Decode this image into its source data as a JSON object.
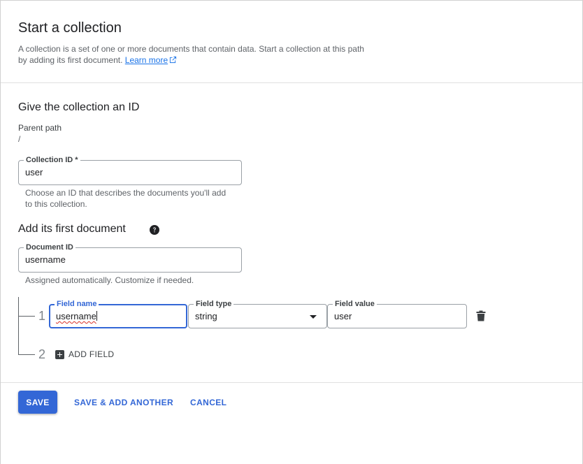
{
  "dialog": {
    "title": "Start a collection",
    "description_line1": "A collection is a set of one or more documents that contain data. Start a collection at this path",
    "description_line2": "by adding its first document.",
    "learn_more": "Learn more"
  },
  "collection_section": {
    "title": "Give the collection an ID",
    "parent_path_label": "Parent path",
    "parent_path_value": "/",
    "collection_id_label": "Collection ID *",
    "collection_id_value": "user",
    "collection_id_hint": "Choose an ID that describes the documents you'll add to this collection."
  },
  "document_section": {
    "title": "Add its first document",
    "document_id_label": "Document ID",
    "document_id_value": "username",
    "document_id_hint": "Assigned automatically. Customize if needed."
  },
  "fields": [
    {
      "index": "1",
      "name_label": "Field name",
      "name_value": "username",
      "type_label": "Field type",
      "type_value": "string",
      "value_label": "Field value",
      "value_value": "user"
    }
  ],
  "add_field": {
    "index": "2",
    "label": "ADD FIELD"
  },
  "footer": {
    "save": "SAVE",
    "save_add_another": "SAVE & ADD ANOTHER",
    "cancel": "CANCEL"
  },
  "colors": {
    "primary": "#3367d6",
    "link": "#1a73e8",
    "error_underline": "#d93025"
  },
  "icons": [
    "external-link-icon",
    "help-icon",
    "dropdown-arrow-icon",
    "trash-icon",
    "plus-icon"
  ]
}
